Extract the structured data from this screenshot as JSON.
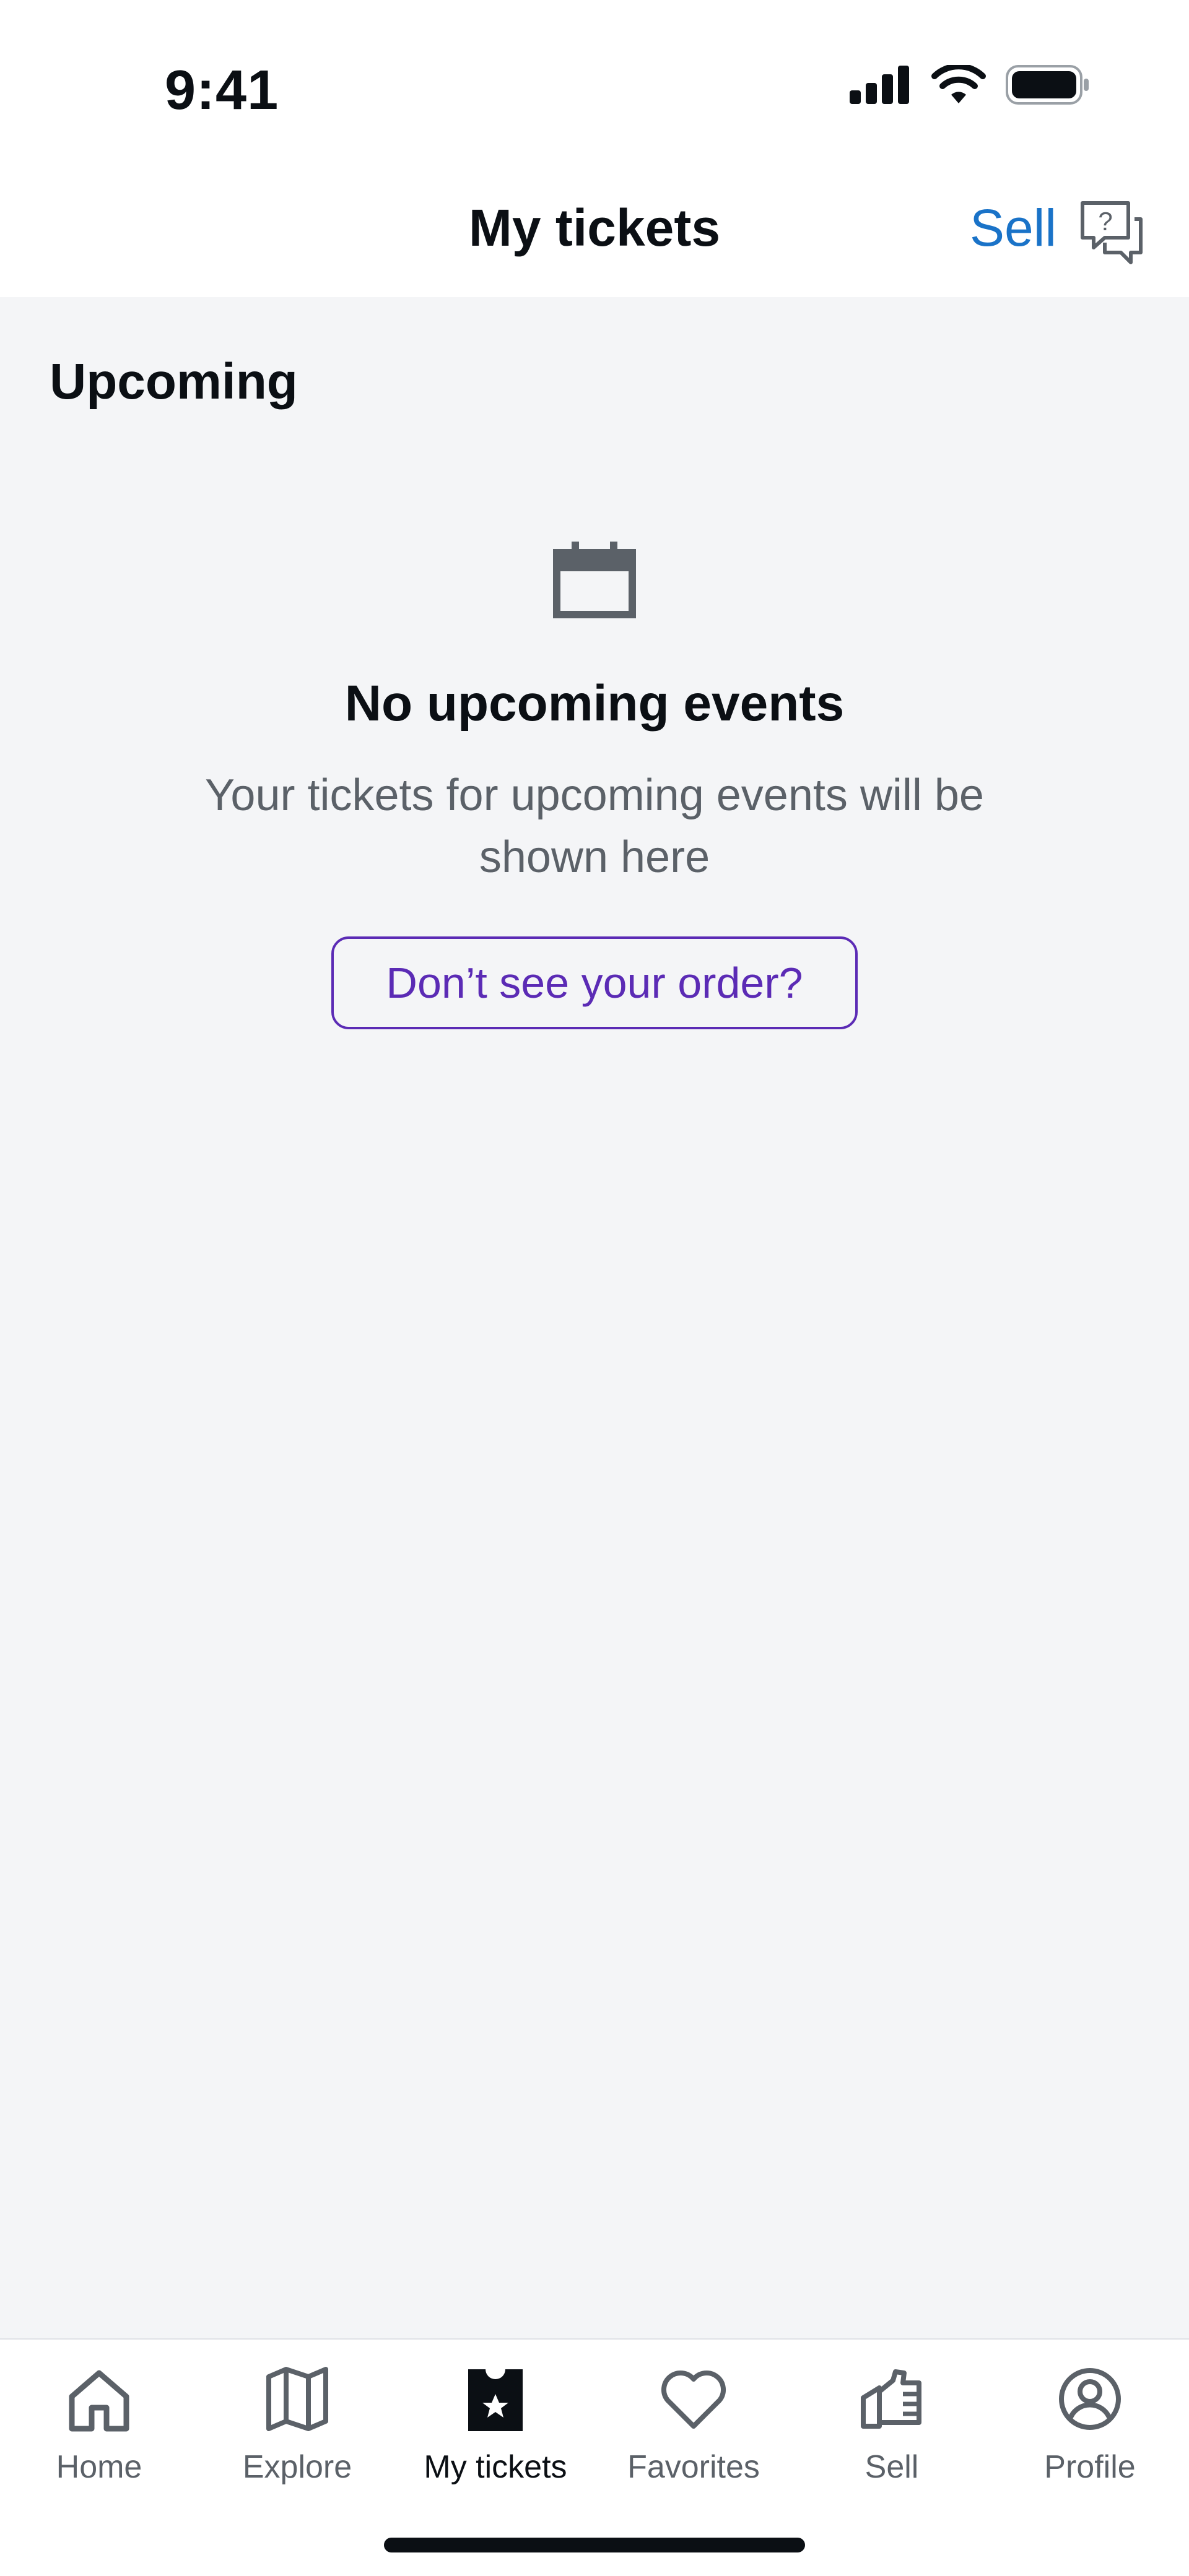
{
  "status_bar": {
    "time": "9:41"
  },
  "header": {
    "title": "My tickets",
    "sell_link": "Sell",
    "help_icon": "help-chat-icon"
  },
  "section": {
    "title": "Upcoming"
  },
  "empty_state": {
    "icon": "calendar-icon",
    "title": "No upcoming events",
    "description": "Your tickets for upcoming events will be shown here",
    "button_label": "Don’t see your order?"
  },
  "colors": {
    "accent_link": "#1a73c8",
    "button_purple": "#5b2bb5",
    "background": "#f4f5f7",
    "text_primary": "#0b0f14",
    "text_secondary": "#5b6168"
  },
  "tabs": [
    {
      "label": "Home",
      "icon": "home-icon",
      "active": false
    },
    {
      "label": "Explore",
      "icon": "map-icon",
      "active": false
    },
    {
      "label": "My tickets",
      "icon": "ticket-star-icon",
      "active": true
    },
    {
      "label": "Favorites",
      "icon": "heart-icon",
      "active": false
    },
    {
      "label": "Sell",
      "icon": "sell-hand-icon",
      "active": false
    },
    {
      "label": "Profile",
      "icon": "profile-icon",
      "active": false
    }
  ]
}
